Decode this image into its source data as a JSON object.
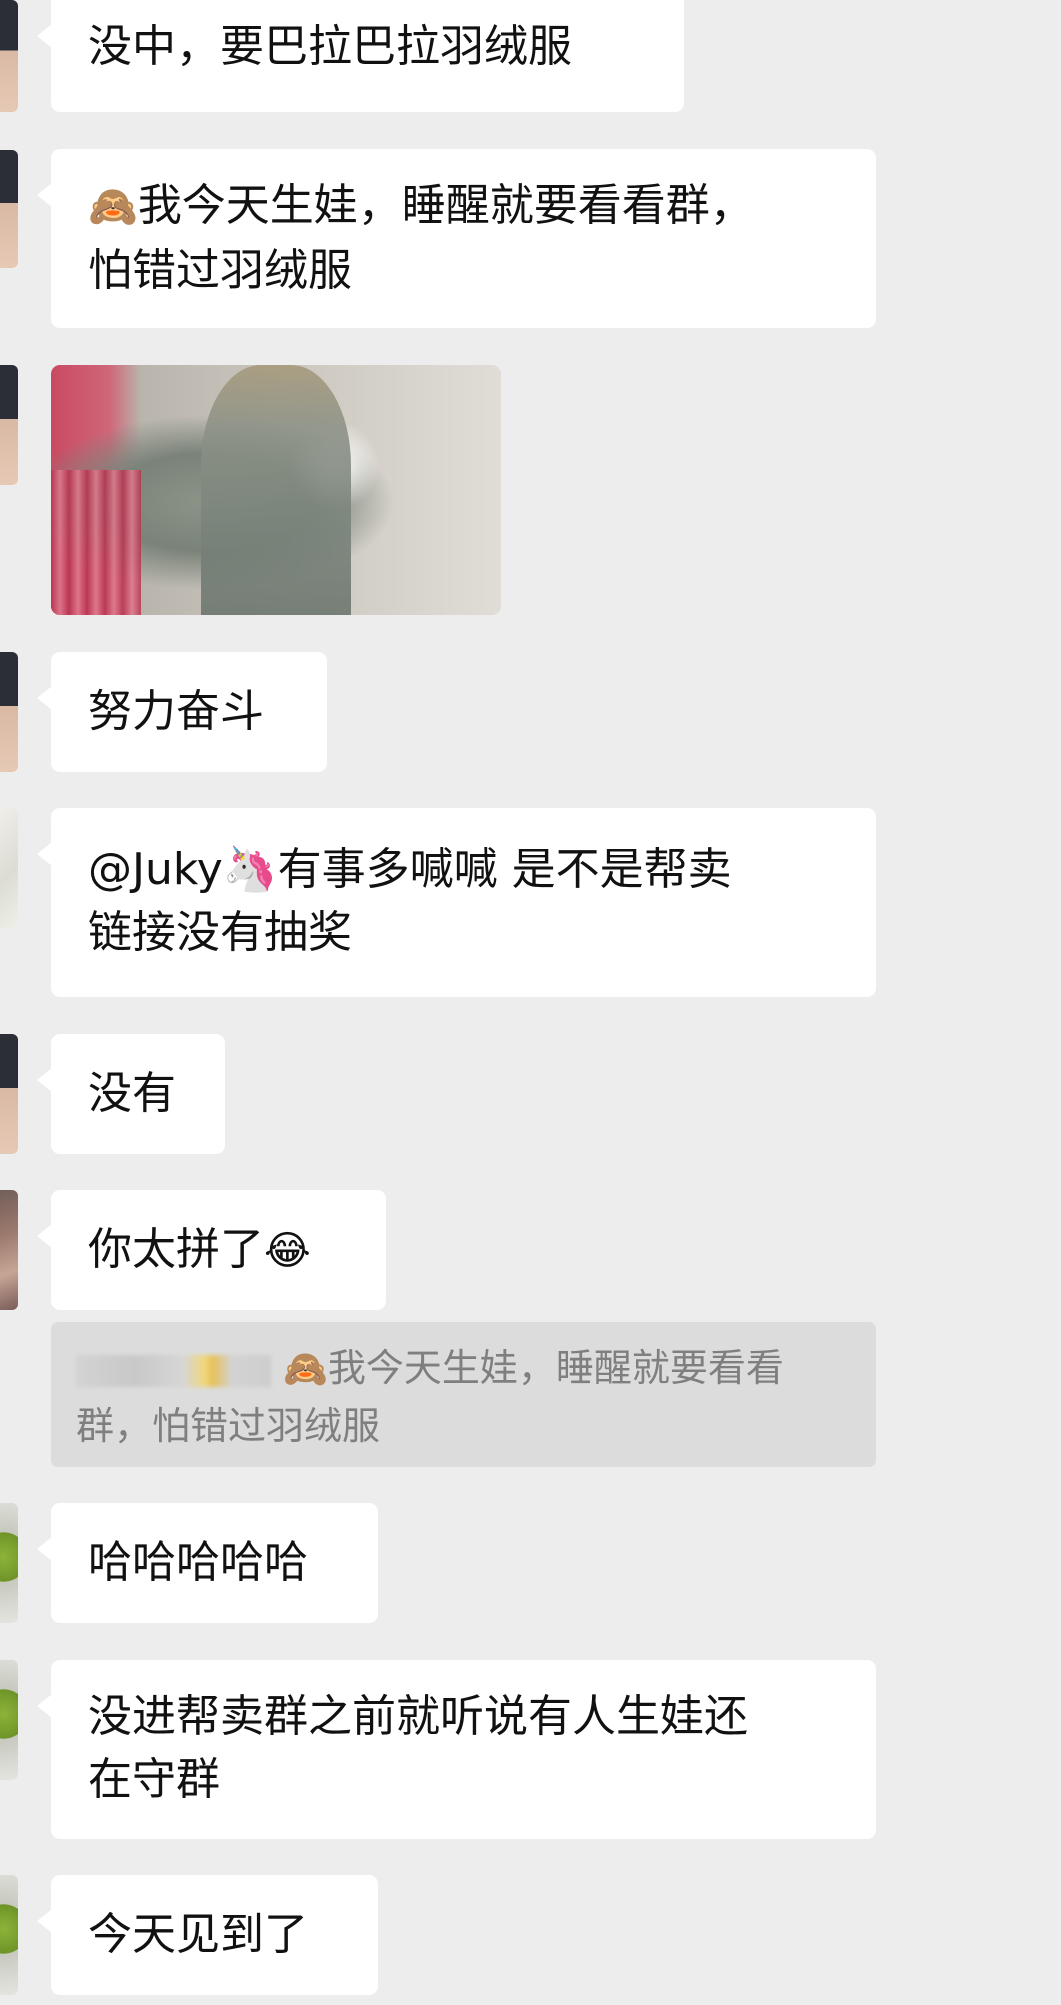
{
  "messages": [
    {
      "text": "没中，要巴拉巴拉羽绒服"
    },
    {
      "emoji": "🙈",
      "text": "我今天生娃，睡醒就要看看群，\n怕错过羽绒服"
    },
    {
      "image": "photo"
    },
    {
      "text": "努力奋斗"
    },
    {
      "text": "@Juky🦄有事多喊喊 是不是帮卖\n链接没有抽奖"
    },
    {
      "text": "没有"
    },
    {
      "text": "你太拼了",
      "emoji": "😂"
    },
    {
      "text": "哈哈哈哈哈"
    },
    {
      "text": "没进帮卖群之前就听说有人生娃还\n在守群"
    },
    {
      "text": "今天见到了"
    }
  ],
  "quote": {
    "emoji": "🙈",
    "text": "我今天生娃，睡醒就要看看\n群，怕错过羽绒服"
  }
}
